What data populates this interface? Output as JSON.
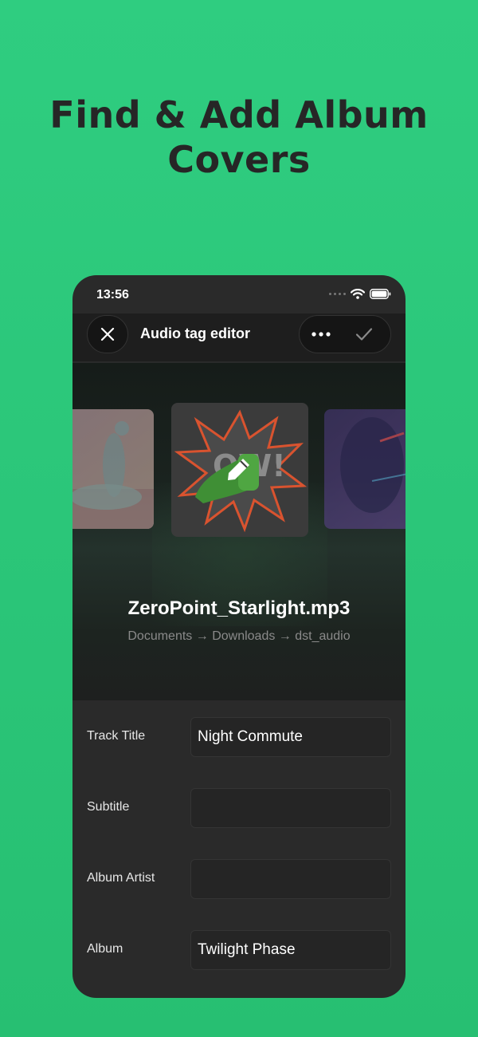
{
  "headline": {
    "line1": "Find & Add Album",
    "line2": "Covers"
  },
  "status_bar": {
    "time": "13:56"
  },
  "nav": {
    "title": "Audio tag editor",
    "close_icon": "close-icon",
    "more_icon": "more-icon",
    "confirm_icon": "checkmark-icon"
  },
  "hero": {
    "file_name": "ZeroPoint_Starlight.mp3",
    "file_path": "Documents → Downloads → dst_audio",
    "covers": [
      "cover-left",
      "cover-center",
      "cover-right"
    ],
    "edit_icon": "pencil-icon"
  },
  "form": {
    "fields": [
      {
        "label": "Track Title",
        "value": "Night Commute"
      },
      {
        "label": "Subtitle",
        "value": ""
      },
      {
        "label": "Album Artist",
        "value": ""
      },
      {
        "label": "Album",
        "value": "Twilight Phase"
      }
    ]
  },
  "colors": {
    "background": "#2fcd80",
    "headline": "#262626",
    "phone": "#2a2a2a"
  }
}
